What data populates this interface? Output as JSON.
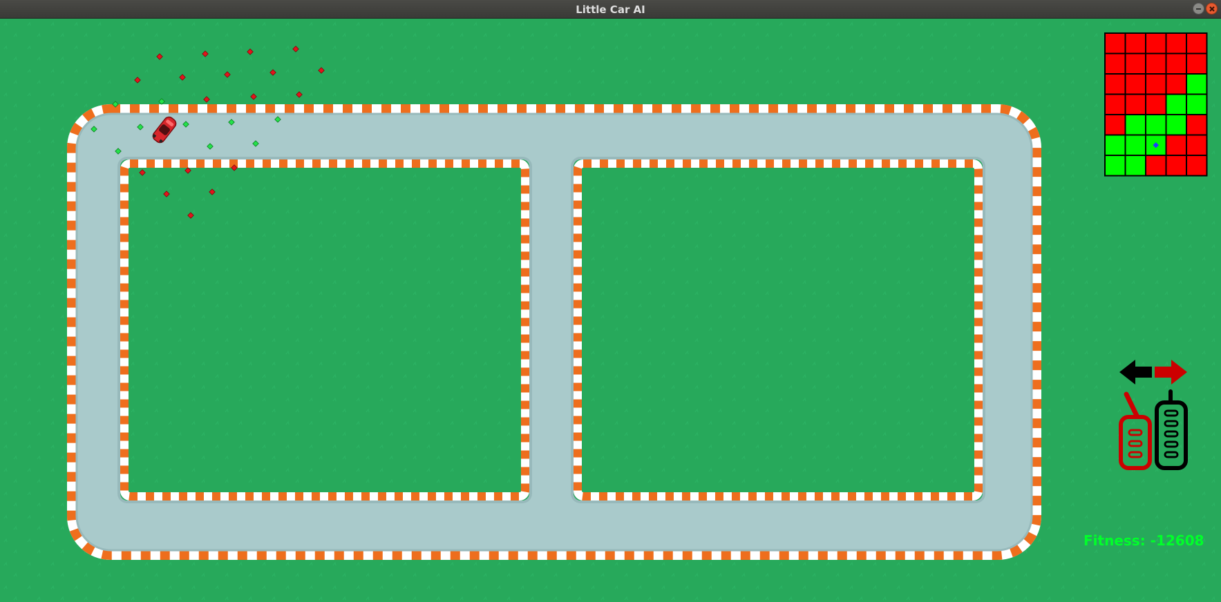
{
  "window": {
    "title": "Little Car AI",
    "buttons": {
      "minimize": "minimize-icon",
      "close": "close-icon"
    }
  },
  "colors": {
    "grass": "#27a95b",
    "track": "#a9cacb",
    "curb_orange": "#ee6e1d",
    "curb_white": "#ffffff",
    "car": "#d8262b",
    "sensor_hit": "#e3141c",
    "sensor_free": "#24e24a",
    "grid_red": "#ff0000",
    "grid_green": "#00ff00",
    "grid_marker": "#1f3cff",
    "arrow_active": "#cc0000",
    "arrow_inactive": "#000000",
    "fitness_text": "#00ff2a"
  },
  "perception_grid": {
    "rows": 7,
    "cols": 5,
    "cells": [
      [
        "red",
        "red",
        "red",
        "red",
        "red"
      ],
      [
        "red",
        "red",
        "red",
        "red",
        "red"
      ],
      [
        "red",
        "red",
        "red",
        "red",
        "green"
      ],
      [
        "red",
        "red",
        "red",
        "green",
        "green"
      ],
      [
        "red",
        "green",
        "green",
        "green",
        "red"
      ],
      [
        "green",
        "green",
        "green",
        "red",
        "red"
      ],
      [
        "green",
        "green",
        "red",
        "red",
        "red"
      ]
    ],
    "car_marker_cell": [
      5,
      2
    ]
  },
  "controls": {
    "steer_left": {
      "icon": "arrow-left-icon",
      "active": false
    },
    "steer_right": {
      "icon": "arrow-right-icon",
      "active": true
    },
    "brake": {
      "icon": "brake-pedal-icon",
      "active": true
    },
    "throttle": {
      "icon": "gas-pedal-icon",
      "active": false
    }
  },
  "hud": {
    "fitness_text": "Fitness: -12608"
  }
}
